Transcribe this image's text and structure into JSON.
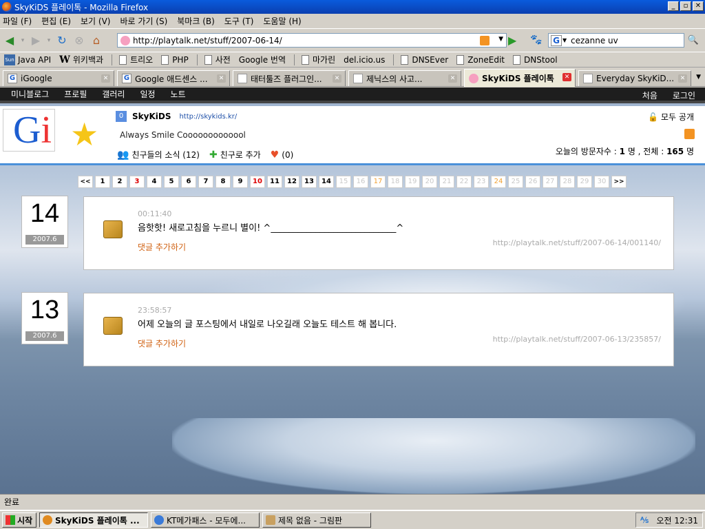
{
  "window": {
    "title": "SkyKiDS 플레이톡 - Mozilla Firefox"
  },
  "menu": [
    "파일 (F)",
    "편집 (E)",
    "보기 (V)",
    "바로 가기 (S)",
    "북마크 (B)",
    "도구 (T)",
    "도움말 (H)"
  ],
  "nav": {
    "url": "http://playtalk.net/stuff/2007-06-14/",
    "search": "cezanne uv"
  },
  "bookmarks": [
    {
      "label": "Java API",
      "icon": "sun-icon"
    },
    {
      "label": "위키백과",
      "icon": "wikipedia-icon"
    },
    {
      "label": "트리오",
      "icon": "page-icon"
    },
    {
      "label": "PHP",
      "icon": "page-icon"
    },
    {
      "label": "사전",
      "icon": "page-icon"
    },
    {
      "label": "Google 번역",
      "icon": "page-icon"
    },
    {
      "label": "마가린",
      "icon": "page-icon"
    },
    {
      "label": "del.icio.us",
      "icon": "page-icon"
    },
    {
      "label": "DNSEver",
      "icon": "page-icon"
    },
    {
      "label": "ZoneEdit",
      "icon": "page-icon"
    },
    {
      "label": "DNStool",
      "icon": "page-icon"
    }
  ],
  "tabs": [
    {
      "label": "iGoogle"
    },
    {
      "label": "Google 애드센스 ..."
    },
    {
      "label": "태터툴즈 플러그인..."
    },
    {
      "label": "제닉스의 사고..."
    },
    {
      "label": "SkyKiDS 플레이톡"
    },
    {
      "label": "Everyday SkyKiD..."
    }
  ],
  "site": {
    "nav_left": [
      "미니블로그",
      "프로필",
      "갤러리",
      "일정",
      "노트"
    ],
    "nav_right": [
      "처음",
      "로그인"
    ],
    "profile": {
      "index": "0",
      "name": "SkyKiDS",
      "url": "http://skykids.kr/",
      "motto": "Always Smile Cooooooooooool",
      "friends_news": "친구들의 소식 (12)",
      "add_friend": "친구로 추가",
      "likes": "(0)",
      "privacy": "모두 공개",
      "visits_label": "오늘의 방문자수 :",
      "visits_today": "1",
      "visits_unit": "명 , 전체 :",
      "visits_total": "165",
      "visits_unit2": "명"
    },
    "pager": {
      "prev": "<<",
      "next": ">>",
      "days": [
        {
          "n": "1",
          "s": "on"
        },
        {
          "n": "2",
          "s": "on"
        },
        {
          "n": "3",
          "s": "red"
        },
        {
          "n": "4",
          "s": "on"
        },
        {
          "n": "5",
          "s": "on"
        },
        {
          "n": "6",
          "s": "on"
        },
        {
          "n": "7",
          "s": "on"
        },
        {
          "n": "8",
          "s": "on"
        },
        {
          "n": "9",
          "s": "on"
        },
        {
          "n": "10",
          "s": "red"
        },
        {
          "n": "11",
          "s": "on"
        },
        {
          "n": "12",
          "s": "on"
        },
        {
          "n": "13",
          "s": "on"
        },
        {
          "n": "14",
          "s": "on"
        },
        {
          "n": "15",
          "s": "dim"
        },
        {
          "n": "16",
          "s": "dim"
        },
        {
          "n": "17",
          "s": "org"
        },
        {
          "n": "18",
          "s": "dim"
        },
        {
          "n": "19",
          "s": "dim"
        },
        {
          "n": "20",
          "s": "dim"
        },
        {
          "n": "21",
          "s": "dim"
        },
        {
          "n": "22",
          "s": "dim"
        },
        {
          "n": "23",
          "s": "dim"
        },
        {
          "n": "24",
          "s": "org"
        },
        {
          "n": "25",
          "s": "dim"
        },
        {
          "n": "26",
          "s": "dim"
        },
        {
          "n": "27",
          "s": "dim"
        },
        {
          "n": "28",
          "s": "dim"
        },
        {
          "n": "29",
          "s": "dim"
        },
        {
          "n": "30",
          "s": "dim"
        }
      ]
    },
    "posts": [
      {
        "day": "14",
        "month": "2007.6",
        "time": "00:11:40",
        "text": "음핫핫! 새로고침을 누르니 별이! ^____________________________^",
        "comment": "댓글 추가하기",
        "permalink": "http://playtalk.net/stuff/2007-06-14/001140/"
      },
      {
        "day": "13",
        "month": "2007.6",
        "time": "23:58:57",
        "text": "어제 오늘의 글 포스팅에서 내일로 나오길래 오늘도 테스트 해 봅니다.",
        "comment": "댓글 추가하기",
        "permalink": "http://playtalk.net/stuff/2007-06-13/235857/"
      }
    ]
  },
  "status": "완료",
  "taskbar": {
    "start": "시작",
    "items": [
      {
        "label": "SkyKiDS 플레이톡 ...",
        "active": true
      },
      {
        "label": "KT메가패스 - 모두에...",
        "active": false
      },
      {
        "label": "제목 없음 - 그림판",
        "active": false
      }
    ],
    "clock": "오전 12:31"
  }
}
